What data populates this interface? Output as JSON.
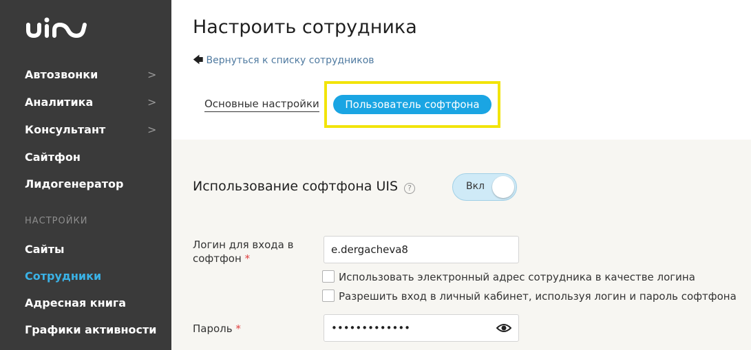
{
  "sidebar": {
    "logo_text": "uis",
    "items": [
      {
        "label": "Автозвонки",
        "chevron": ">"
      },
      {
        "label": "Аналитика",
        "chevron": ">"
      },
      {
        "label": "Консультант",
        "chevron": ">"
      },
      {
        "label": "Сайтфон",
        "chevron": ""
      },
      {
        "label": "Лидогенератор",
        "chevron": ""
      }
    ],
    "section_label": "НАСТРОЙКИ",
    "settings_items": [
      {
        "label": "Сайты"
      },
      {
        "label": "Сотрудники"
      },
      {
        "label": "Адресная книга"
      },
      {
        "label": "Графики активности"
      }
    ],
    "active_item": "Сотрудники"
  },
  "main": {
    "title": "Настроить сотрудника",
    "back_link": "Вернуться к списку сотрудников",
    "tabs": [
      {
        "label": "Основные настройки"
      },
      {
        "label": "Пользователь софтфона"
      }
    ],
    "active_tab": "Пользователь софтфона",
    "section_title": "Использование софтфона UIS",
    "help_glyph": "?",
    "toggle_label": "Вкл",
    "login_label_line1": "Логин для входа в",
    "login_label_line2": "софтфон",
    "required_mark": "*",
    "login_value": "e.dergacheva8",
    "checkbox1_label": "Использовать электронный адрес сотрудника в качестве логина",
    "checkbox2_label": "Разрешить вход в личный кабинет, используя логин и пароль софтфона",
    "password_label": "Пароль",
    "password_value": "•••••••••••••"
  },
  "colors": {
    "sidebar_bg": "#3a3a3a",
    "accent": "#1aa5e3",
    "active_nav": "#3ab2e6",
    "highlight": "#f2e40a",
    "panel_bg": "#f7f6f2"
  },
  "icons": [
    "back-arrow-icon",
    "help-icon",
    "eye-icon",
    "chevron-right-icon"
  ]
}
